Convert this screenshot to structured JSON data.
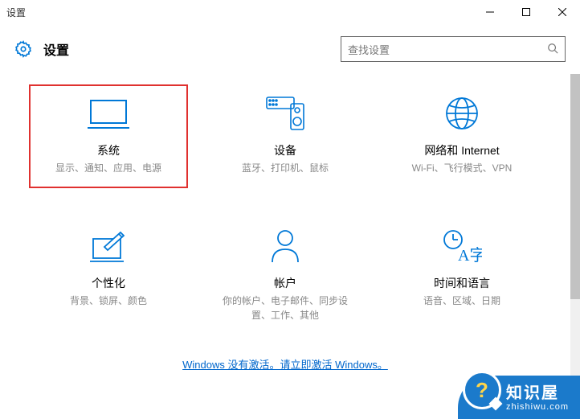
{
  "window": {
    "title": "设置"
  },
  "header": {
    "title": "设置",
    "search_placeholder": "查找设置"
  },
  "tiles": [
    {
      "title": "系统",
      "desc": "显示、通知、应用、电源"
    },
    {
      "title": "设备",
      "desc": "蓝牙、打印机、鼠标"
    },
    {
      "title": "网络和 Internet",
      "desc": "Wi-Fi、飞行模式、VPN"
    },
    {
      "title": "个性化",
      "desc": "背景、锁屏、颜色"
    },
    {
      "title": "帐户",
      "desc": "你的帐户、电子邮件、同步设置、工作、其他"
    },
    {
      "title": "时间和语言",
      "desc": "语音、区域、日期"
    }
  ],
  "activation": {
    "text": "Windows 没有激活。请立即激活 Windows。"
  },
  "watermark": {
    "glyph": "?",
    "main": "知识屋",
    "sub": "zhishiwu.com"
  }
}
